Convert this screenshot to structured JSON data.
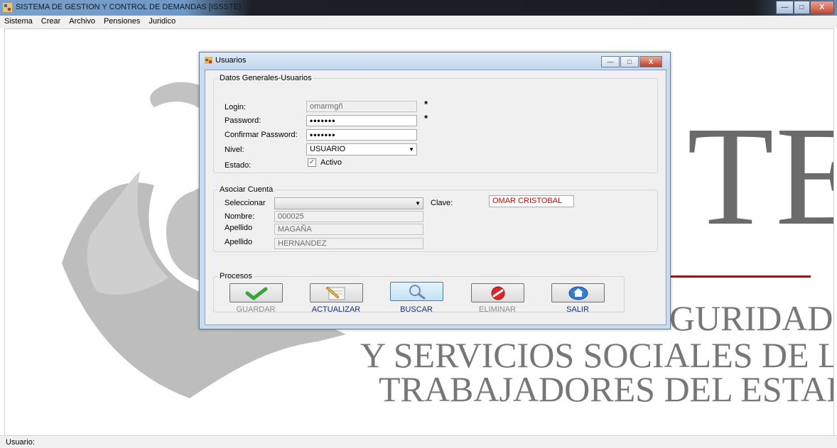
{
  "window": {
    "title": "SISTEMA DE GESTION Y CONTROL DE DEMANDAS [ISSSTE]",
    "controls": {
      "minimize": "—",
      "maximize": "□",
      "close": "X"
    }
  },
  "menu": [
    "Sistema",
    "Crear",
    "Archivo",
    "Pensiones",
    "Juridico"
  ],
  "background_logo": {
    "letters": "TE",
    "line1": "GURIDAD",
    "line2": "Y SERVICIOS SOCIALES DE LOS",
    "line3": "TRABAJADORES DEL ESTADO"
  },
  "dialog": {
    "title": "Usuarios",
    "datos_generales": {
      "legend": "Datos Generales-Usuarios",
      "login_label": "Login:",
      "login_value": "omarmgñ",
      "password_label": "Password:",
      "password_value": "•••••••",
      "confirm_label": "Confirmar Password:",
      "confirm_value": "•••••••",
      "nivel_label": "Nivel:",
      "nivel_value": "USUARIO",
      "estado_label": "Estado:",
      "activo_label": "Activo",
      "activo_checked": true,
      "required_mark": "*"
    },
    "asociar_cuenta": {
      "legend": "Asociar Cuenta",
      "seleccionar_label": "Seleccionar",
      "seleccionar_value": "",
      "clave_label": "Clave:",
      "clave_value": "OMAR CRISTOBAL",
      "nombre_label": "Nombre:",
      "nombre_value": "000025",
      "apellido1_label": "Apellido",
      "apellido1_value": "MAGAÑA",
      "apellido2_label": "Apellido",
      "apellido2_value": "HERNANDEZ"
    },
    "procesos": {
      "legend": "Procesos",
      "buttons": [
        {
          "label": "GUARDAR",
          "icon": "check-icon",
          "enabled": false
        },
        {
          "label": "ACTUALIZAR",
          "icon": "edit-pencil-icon",
          "enabled": true
        },
        {
          "label": "BUSCAR",
          "icon": "magnifier-icon",
          "enabled": true
        },
        {
          "label": "ELIMINAR",
          "icon": "delete-icon",
          "enabled": false
        },
        {
          "label": "SALIR",
          "icon": "home-exit-icon",
          "enabled": true
        }
      ]
    }
  },
  "status": {
    "usuario_label": "Usuario:"
  },
  "colors": {
    "required_red": "#e00000",
    "logo_red_line": "#8d1a1a",
    "disabled_text": "#8e8e8e"
  }
}
